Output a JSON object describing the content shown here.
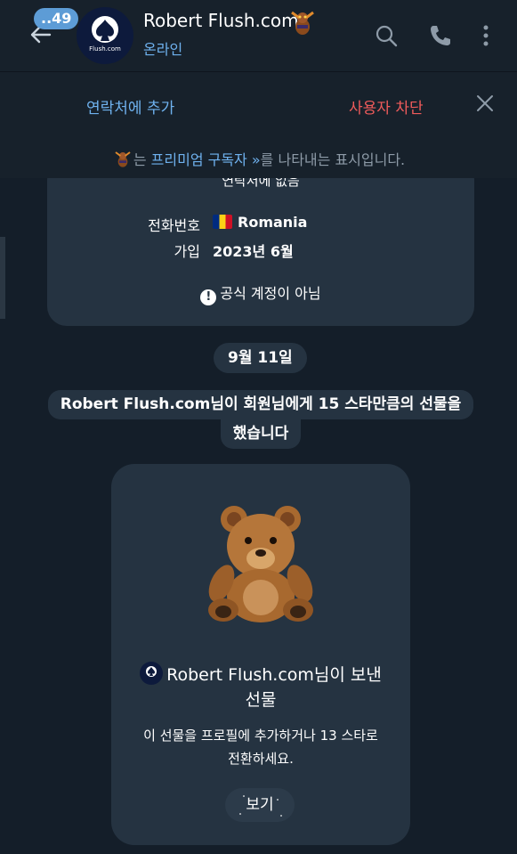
{
  "header": {
    "unread_count": "..49",
    "avatar_text": "Flush.com",
    "title": "Robert Flush.com",
    "status": "온라인",
    "icons": [
      "back-arrow-icon",
      "search-icon",
      "phone-icon",
      "more-vert-icon"
    ]
  },
  "action_bar": {
    "add_contact": "연락처에 추가",
    "block_user": "사용자 차단",
    "close_icon": "close-icon"
  },
  "premium_note": {
    "prefix": "는 ",
    "link": "프리미엄 구독자 »",
    "suffix": "를 나타내는 표시입니다."
  },
  "info_card": {
    "cut_text": "연락처에 없음",
    "rows": [
      {
        "label": "전화번호",
        "value": "Romania"
      },
      {
        "label": "가입",
        "value": "2023년 6월"
      }
    ],
    "notice": "공식 계정이 아님"
  },
  "date_pill": "9월 11일",
  "service_message": {
    "line1": "Robert Flush.com님이 회원님에게 15 스타만큼의 선물을",
    "line2": "했습니다"
  },
  "gift_card": {
    "title_line1": "Robert Flush.com님이 보낸",
    "title_line2": "선물",
    "desc_line1": "이 선물을 프로필에 추가하거나 13 스타로",
    "desc_line2": "전환하세요.",
    "button": "보기"
  },
  "colors": {
    "background": "#141e29",
    "header": "#17212b",
    "card": "#253341",
    "accent": "#6fb2ef",
    "danger": "#ef5b5b"
  }
}
